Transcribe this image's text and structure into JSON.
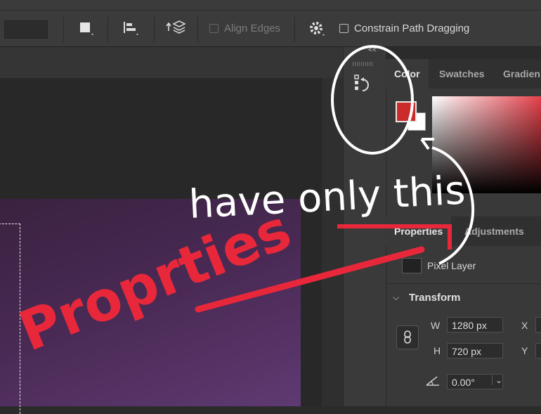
{
  "options_bar": {
    "align_edges_label": "Align Edges",
    "constrain_label": "Constrain Path Dragging",
    "icons": [
      "fill-swatch-icon",
      "path-align-icon",
      "path-arrange-icon",
      "gear-icon"
    ]
  },
  "dock": {
    "collapse_glyph": "<<",
    "history_icon": "history-icon"
  },
  "color_panel": {
    "tabs": [
      "Color",
      "Swatches",
      "Gradien"
    ],
    "foreground_color": "#cc2b2b",
    "background_color": "#ffffff"
  },
  "properties_panel": {
    "tabs": [
      "Properties",
      "Adjustments"
    ],
    "layer_type": "Pixel Layer",
    "section_title": "Transform",
    "w_label": "W",
    "w_value": "1280 px",
    "h_label": "H",
    "h_value": "720 px",
    "x_label": "X",
    "y_label": "Y",
    "angle_value": "0.00°"
  },
  "annotation": {
    "red_text": "Proprties",
    "white_text": "have only this"
  }
}
